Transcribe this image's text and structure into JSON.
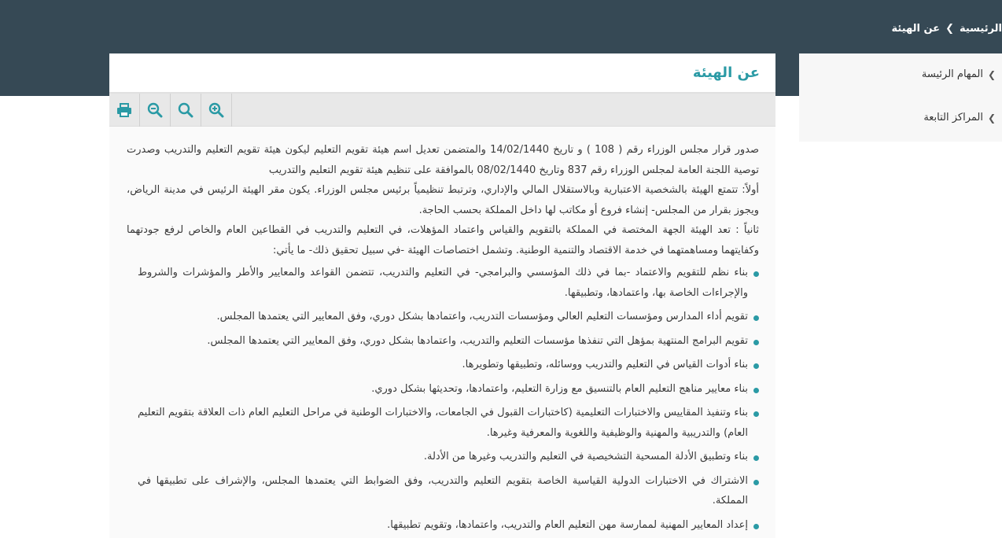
{
  "breadcrumb": {
    "home": "الرئيسية",
    "current": "عن الهيئة"
  },
  "sidebar": {
    "items": [
      {
        "label": "المهام الرئيسة"
      },
      {
        "label": "المراكز التابعة"
      }
    ]
  },
  "page": {
    "title": "عن الهيئة"
  },
  "toolbar": {
    "icons": [
      "print-icon",
      "zoom-out-icon",
      "zoom-reset-icon",
      "zoom-in-icon"
    ]
  },
  "content": {
    "paragraphs": [
      "صدور قرار مجلس الوزراء رقم ( 108 ) و تاريخ 14/02/1440 والمتضمن تعديل اسم هيئة تقويم التعليم ليكون هيئة تقويم التعليم والتدريب وصدرت توصية اللجنة العامة لمجلس الوزراء رقم 837 وتاريخ 08/02/1440 بالموافقة على تنظيم هيئة تقويم التعليم والتدريب",
      "أولاً: تتمتع الهيئة بالشخصية الاعتبارية وبالاستقلال المالي والإداري، وترتبط تنظيمياً برئيس مجلس الوزراء. يكون مقر الهيئة الرئيس في مدينة الرياض، ويجوز بقرار من المجلس- إنشاء فروع أو مكاتب لها داخل المملكة بحسب الحاجة.",
      "ثانياً : تعد الهيئة الجهة المختصة في المملكة بالتقويم والقياس واعتماد المؤهلات، في التعليم والتدريب في القطاعين العام والخاص لرفع جودتهما وكفايتهما ومساهمتهما في خدمة الاقتصاد والتنمية الوطنية. وتشمل اختصاصات الهيئة -في سبيل تحقيق ذلك- ما يأتي:"
    ],
    "items": [
      "بناء نظم للتقويم والاعتماد -بما في ذلك المؤسسي والبرامجي- في التعليم والتدريب، تتضمن القواعد والمعايير والأطر والمؤشرات والشروط والإجراءات الخاصة بها، واعتمادها، وتطبيقها.",
      "تقويم أداء المدارس ومؤسسات التعليم العالي ومؤسسات التدريب، واعتمادها بشكل دوري، وفق المعايير التي يعتمدها المجلس.",
      "تقويم البرامج المنتهية بمؤهل التي تنفذها مؤسسات التعليم والتدريب، واعتمادها بشكل دوري، وفق المعايير التي يعتمدها المجلس.",
      "بناء أدوات القياس في التعليم والتدريب ووسائله، وتطبيقها وتطويرها.",
      " بناء معايير مناهج التعليم العام بالتنسيق مع وزارة التعليم، واعتمادها، وتحديثها بشكل دوري.",
      "بناء وتنفيذ المقاييس والاختبارات التعليمية (كاختبارات القبول في الجامعات، والاختبارات الوطنية في مراحل التعليم العام ذات العلاقة بتقويم التعليم العام) والتدريبية والمهنية والوظيفية واللغوية والمعرفية وغيرها.",
      "بناء وتطبيق الأدلة المسحية التشخيصية في التعليم والتدريب وغيرها من الأدلة.",
      "الاشتراك في الاختبارات الدولية القياسية الخاصة بتقويم التعليم والتدريب، وفق الضوابط التي يعتمدها المجلس، والإشراف على تطبيقها في المملكة.",
      "إعداد المعايير المهنية لممارسة مهن التعليم العام والتدريب، واعتمادها، وتقويم تطبيقها."
    ]
  },
  "colors": {
    "header_band": "#364955",
    "accent": "#2a9aa5",
    "toolbar_bg": "#e8e8e8",
    "panel_bg": "#fafafa",
    "sidebar_bg": "#f7f7f7"
  }
}
